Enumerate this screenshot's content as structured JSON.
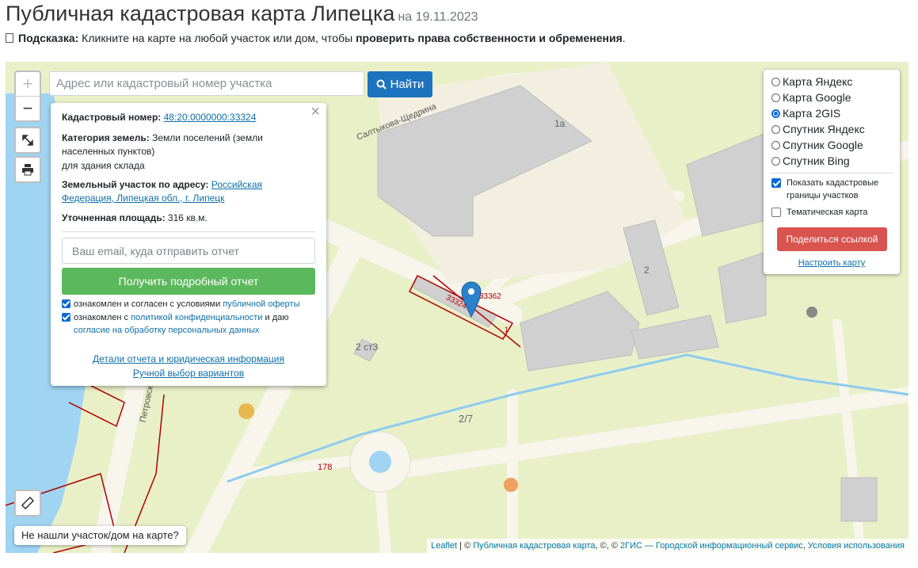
{
  "page": {
    "title": "Публичная кадастровая карта Липецка",
    "date": "на 19.11.2023",
    "hint_label": "Подсказка:",
    "hint_text": " Кликните на карте на любой участок или дом, чтобы ",
    "hint_bold": "проверить права собственности и обременения",
    "hint_end": "."
  },
  "map": {
    "search_placeholder": "Адрес или кадастровый номер участка",
    "search_button": "Найти",
    "zoom_in": "+",
    "zoom_out": "−",
    "labels": {
      "street": "Салтыкова-Щедрина",
      "street2": "Петровский",
      "b1a": "1а",
      "b2": "2",
      "b2st3": "2 ст3",
      "b27": "2/7",
      "n178": "178",
      "parcel_a": "33324",
      "parcel_b": "33362",
      "parcel_c": "1"
    },
    "not_found": "Не нашли участок/дом на карте?"
  },
  "popup": {
    "close": "×",
    "cad_label": "Кадастровый номер:",
    "cad_value": "48:20:0000000:33324",
    "cat_label": "Категория земель:",
    "cat_value": " Земли поселений (земли населенных пунктов)",
    "purpose": "для здания склада",
    "addr_label": "Земельный участок по адресу:",
    "addr_value": "Российская Федерация, Липецкая обл., г. Липецк",
    "area_label": "Уточненная площадь:",
    "area_value": " 316 кв.м.",
    "email_placeholder": "Ваш email, куда отправить отчет",
    "get_button": "Получить подробный отчет",
    "chk1_text": "ознакомлен и согласен с условиями ",
    "chk1_link": "публичной оферты",
    "chk2_text": "ознакомлен с ",
    "chk2_link": "политикой конфиденциальности",
    "chk2_mid": " и даю ",
    "chk2_link2": "согласие на обработку персональных данных",
    "details_link": "Детали отчета и юридическая информация",
    "manual_link": "Ручной выбор вариантов"
  },
  "layers": {
    "options": [
      "Карта Яндекс",
      "Карта Google",
      "Карта 2GIS",
      "Спутник Яндекс",
      "Спутник Google",
      "Спутник Bing"
    ],
    "selected": "Карта 2GIS",
    "show_borders": "Показать кадастровые границы участков",
    "thematic": "Тематическая карта",
    "share_button": "Поделиться ссылкой",
    "configure_link": "Настроить карту"
  },
  "attribution": {
    "leaflet": "Leaflet",
    "sep1": " | © ",
    "pkk": "Публичная кадастровая карта",
    "sep2": ", ©, © ",
    "gis": "2ГИС — Городской информационный сервис",
    "sep3": ", ",
    "terms": "Условия использования"
  },
  "colors": {
    "map_bg": "#e9f0c8",
    "road": "#f7f5ec",
    "building": "#d0d0d0",
    "water": "#9fd4f2",
    "parcel": "#b00000",
    "marker": "#2b82cb",
    "green_button": "#5cb85c",
    "red_button": "#d9534f",
    "blue_button": "#1e73be"
  }
}
